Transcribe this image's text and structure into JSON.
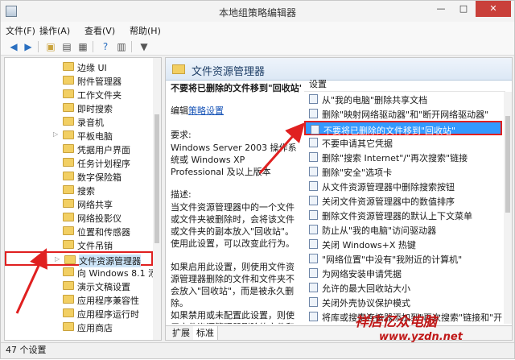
{
  "window": {
    "title": "本地组策略编辑器",
    "min": "—",
    "max": "□",
    "close": "✕"
  },
  "menu": [
    "文件(F)",
    "操作(A)",
    "查看(V)",
    "帮助(H)"
  ],
  "toolbar": [
    "back-icon",
    "forward-icon",
    "up-folder-icon",
    "show-hide-tree-icon",
    "export-icon",
    "help-icon",
    "properties-icon",
    "filter-icon"
  ],
  "tree": {
    "items": [
      {
        "label": "边缘 UI",
        "expandable": false
      },
      {
        "label": "附件管理器",
        "expandable": false
      },
      {
        "label": "工作文件夹",
        "expandable": false
      },
      {
        "label": "即时搜索",
        "expandable": false
      },
      {
        "label": "录音机",
        "expandable": false
      },
      {
        "label": "平板电脑",
        "expandable": true
      },
      {
        "label": "凭据用户界面",
        "expandable": false
      },
      {
        "label": "任务计划程序",
        "expandable": false
      },
      {
        "label": "数字保险箱",
        "expandable": false
      },
      {
        "label": "搜索",
        "expandable": false
      },
      {
        "label": "网络共享",
        "expandable": false
      },
      {
        "label": "网络投影仪",
        "expandable": false
      },
      {
        "label": "位置和传感器",
        "expandable": false
      },
      {
        "label": "文件吊销",
        "expandable": false
      },
      {
        "label": "文件资源管理器",
        "expandable": true,
        "selected": true
      },
      {
        "label": "向 Windows 8.1 添加",
        "expandable": false
      },
      {
        "label": "演示文稿设置",
        "expandable": false
      },
      {
        "label": "应用程序兼容性",
        "expandable": false
      },
      {
        "label": "应用程序运行时",
        "expandable": false
      },
      {
        "label": "应用商店",
        "expandable": false
      }
    ]
  },
  "pane": {
    "title": "文件资源管理器",
    "desc_title": "不要将已删除的文件移到\"回收站\"",
    "edit_prefix": "编辑",
    "edit_link": "策略设置",
    "requirement_label": "要求:",
    "requirement_text": "Windows Server 2003 操作系统或 Windows XP Professional 及以上版本",
    "description_label": "描述:",
    "description_text": "当文件资源管理器中的一个文件或文件夹被删除时，会将该文件或文件夹的副本放入\"回收站\"。使用此设置，可以改变此行为。",
    "enable_text": "如果启用此设置，则使用文件资源管理器删除的文件和文件夹不会放入\"回收站\"，而是被永久删除。",
    "disable_text": "如果禁用或未配置此设置，则使用文件资源管理器删除的文件和文件夹将放入\"回收站\"。"
  },
  "list": {
    "header": "设置",
    "items": [
      "从\"我的电脑\"删除共享文档",
      "删除\"映射网络驱动器\"和\"断开网络驱动器\"",
      "不要将已删除的文件移到\"回收站\"",
      "不要申请其它凭据",
      "删除\"搜索 Internet\"/\"再次搜索\"链接",
      "删除\"安全\"选项卡",
      "从文件资源管理器中删除搜索按钮",
      "关闭文件资源管理器中的数值排序",
      "删除文件资源管理器的默认上下文菜单",
      "防止从\"我的电脑\"访问驱动器",
      "关闭 Windows+X 热键",
      "\"网络位置\"中没有\"我附近的计算机\"",
      "为网络安装申请凭据",
      "允许的最大回收站大小",
      "关闭外壳协议保护模式",
      "将库或搜索连接器添加到\"再次搜索\"链接和\"开始\""
    ],
    "selected_index": 2
  },
  "tabs": [
    "扩展",
    "标准"
  ],
  "status": "47 个设置",
  "watermark": {
    "text": "祥店亿众电脑",
    "url": "www.yzdn.net"
  }
}
